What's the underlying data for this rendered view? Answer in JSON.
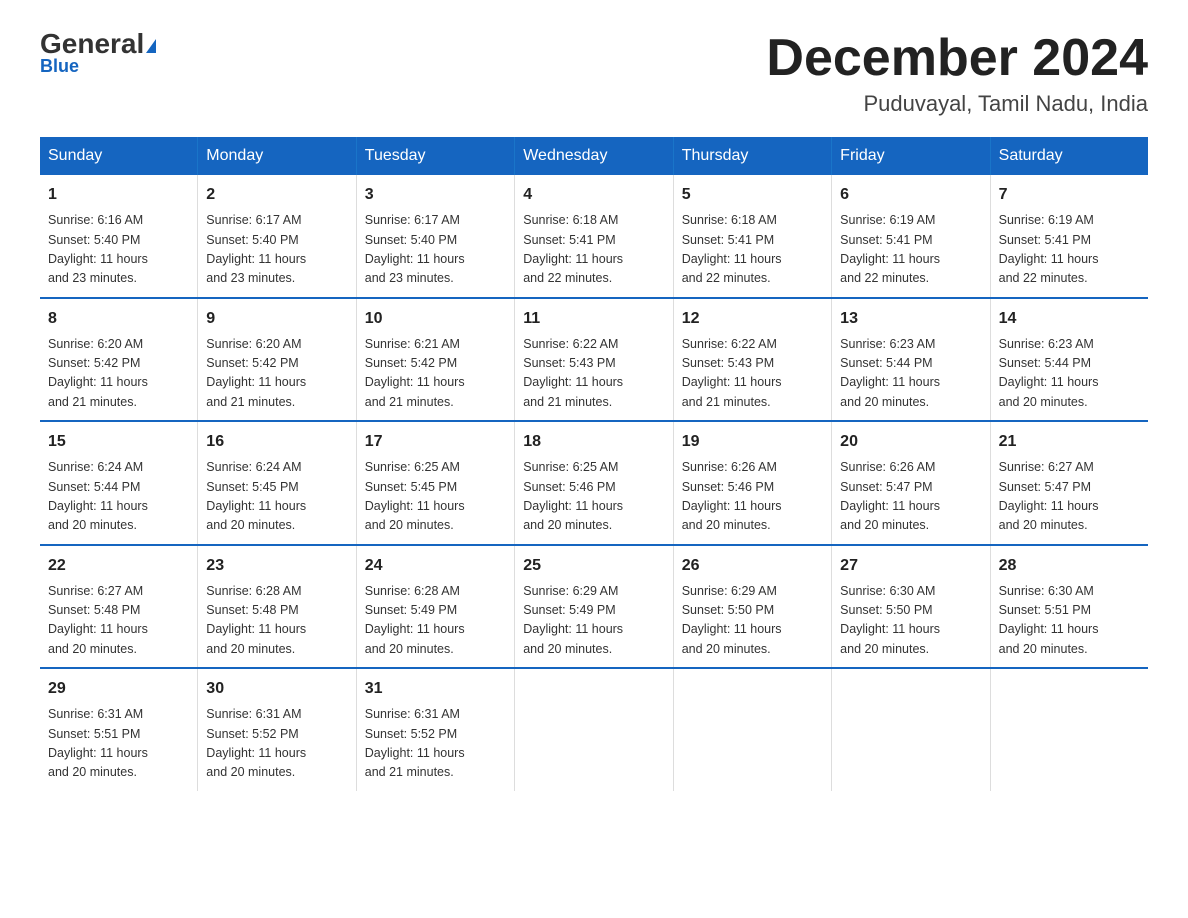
{
  "logo": {
    "name": "General",
    "name2": "Blue"
  },
  "title": "December 2024",
  "subtitle": "Puduvayal, Tamil Nadu, India",
  "days_of_week": [
    "Sunday",
    "Monday",
    "Tuesday",
    "Wednesday",
    "Thursday",
    "Friday",
    "Saturday"
  ],
  "weeks": [
    [
      {
        "day": "1",
        "info": "Sunrise: 6:16 AM\nSunset: 5:40 PM\nDaylight: 11 hours\nand 23 minutes."
      },
      {
        "day": "2",
        "info": "Sunrise: 6:17 AM\nSunset: 5:40 PM\nDaylight: 11 hours\nand 23 minutes."
      },
      {
        "day": "3",
        "info": "Sunrise: 6:17 AM\nSunset: 5:40 PM\nDaylight: 11 hours\nand 23 minutes."
      },
      {
        "day": "4",
        "info": "Sunrise: 6:18 AM\nSunset: 5:41 PM\nDaylight: 11 hours\nand 22 minutes."
      },
      {
        "day": "5",
        "info": "Sunrise: 6:18 AM\nSunset: 5:41 PM\nDaylight: 11 hours\nand 22 minutes."
      },
      {
        "day": "6",
        "info": "Sunrise: 6:19 AM\nSunset: 5:41 PM\nDaylight: 11 hours\nand 22 minutes."
      },
      {
        "day": "7",
        "info": "Sunrise: 6:19 AM\nSunset: 5:41 PM\nDaylight: 11 hours\nand 22 minutes."
      }
    ],
    [
      {
        "day": "8",
        "info": "Sunrise: 6:20 AM\nSunset: 5:42 PM\nDaylight: 11 hours\nand 21 minutes."
      },
      {
        "day": "9",
        "info": "Sunrise: 6:20 AM\nSunset: 5:42 PM\nDaylight: 11 hours\nand 21 minutes."
      },
      {
        "day": "10",
        "info": "Sunrise: 6:21 AM\nSunset: 5:42 PM\nDaylight: 11 hours\nand 21 minutes."
      },
      {
        "day": "11",
        "info": "Sunrise: 6:22 AM\nSunset: 5:43 PM\nDaylight: 11 hours\nand 21 minutes."
      },
      {
        "day": "12",
        "info": "Sunrise: 6:22 AM\nSunset: 5:43 PM\nDaylight: 11 hours\nand 21 minutes."
      },
      {
        "day": "13",
        "info": "Sunrise: 6:23 AM\nSunset: 5:44 PM\nDaylight: 11 hours\nand 20 minutes."
      },
      {
        "day": "14",
        "info": "Sunrise: 6:23 AM\nSunset: 5:44 PM\nDaylight: 11 hours\nand 20 minutes."
      }
    ],
    [
      {
        "day": "15",
        "info": "Sunrise: 6:24 AM\nSunset: 5:44 PM\nDaylight: 11 hours\nand 20 minutes."
      },
      {
        "day": "16",
        "info": "Sunrise: 6:24 AM\nSunset: 5:45 PM\nDaylight: 11 hours\nand 20 minutes."
      },
      {
        "day": "17",
        "info": "Sunrise: 6:25 AM\nSunset: 5:45 PM\nDaylight: 11 hours\nand 20 minutes."
      },
      {
        "day": "18",
        "info": "Sunrise: 6:25 AM\nSunset: 5:46 PM\nDaylight: 11 hours\nand 20 minutes."
      },
      {
        "day": "19",
        "info": "Sunrise: 6:26 AM\nSunset: 5:46 PM\nDaylight: 11 hours\nand 20 minutes."
      },
      {
        "day": "20",
        "info": "Sunrise: 6:26 AM\nSunset: 5:47 PM\nDaylight: 11 hours\nand 20 minutes."
      },
      {
        "day": "21",
        "info": "Sunrise: 6:27 AM\nSunset: 5:47 PM\nDaylight: 11 hours\nand 20 minutes."
      }
    ],
    [
      {
        "day": "22",
        "info": "Sunrise: 6:27 AM\nSunset: 5:48 PM\nDaylight: 11 hours\nand 20 minutes."
      },
      {
        "day": "23",
        "info": "Sunrise: 6:28 AM\nSunset: 5:48 PM\nDaylight: 11 hours\nand 20 minutes."
      },
      {
        "day": "24",
        "info": "Sunrise: 6:28 AM\nSunset: 5:49 PM\nDaylight: 11 hours\nand 20 minutes."
      },
      {
        "day": "25",
        "info": "Sunrise: 6:29 AM\nSunset: 5:49 PM\nDaylight: 11 hours\nand 20 minutes."
      },
      {
        "day": "26",
        "info": "Sunrise: 6:29 AM\nSunset: 5:50 PM\nDaylight: 11 hours\nand 20 minutes."
      },
      {
        "day": "27",
        "info": "Sunrise: 6:30 AM\nSunset: 5:50 PM\nDaylight: 11 hours\nand 20 minutes."
      },
      {
        "day": "28",
        "info": "Sunrise: 6:30 AM\nSunset: 5:51 PM\nDaylight: 11 hours\nand 20 minutes."
      }
    ],
    [
      {
        "day": "29",
        "info": "Sunrise: 6:31 AM\nSunset: 5:51 PM\nDaylight: 11 hours\nand 20 minutes."
      },
      {
        "day": "30",
        "info": "Sunrise: 6:31 AM\nSunset: 5:52 PM\nDaylight: 11 hours\nand 20 minutes."
      },
      {
        "day": "31",
        "info": "Sunrise: 6:31 AM\nSunset: 5:52 PM\nDaylight: 11 hours\nand 21 minutes."
      },
      {
        "day": "",
        "info": ""
      },
      {
        "day": "",
        "info": ""
      },
      {
        "day": "",
        "info": ""
      },
      {
        "day": "",
        "info": ""
      }
    ]
  ]
}
